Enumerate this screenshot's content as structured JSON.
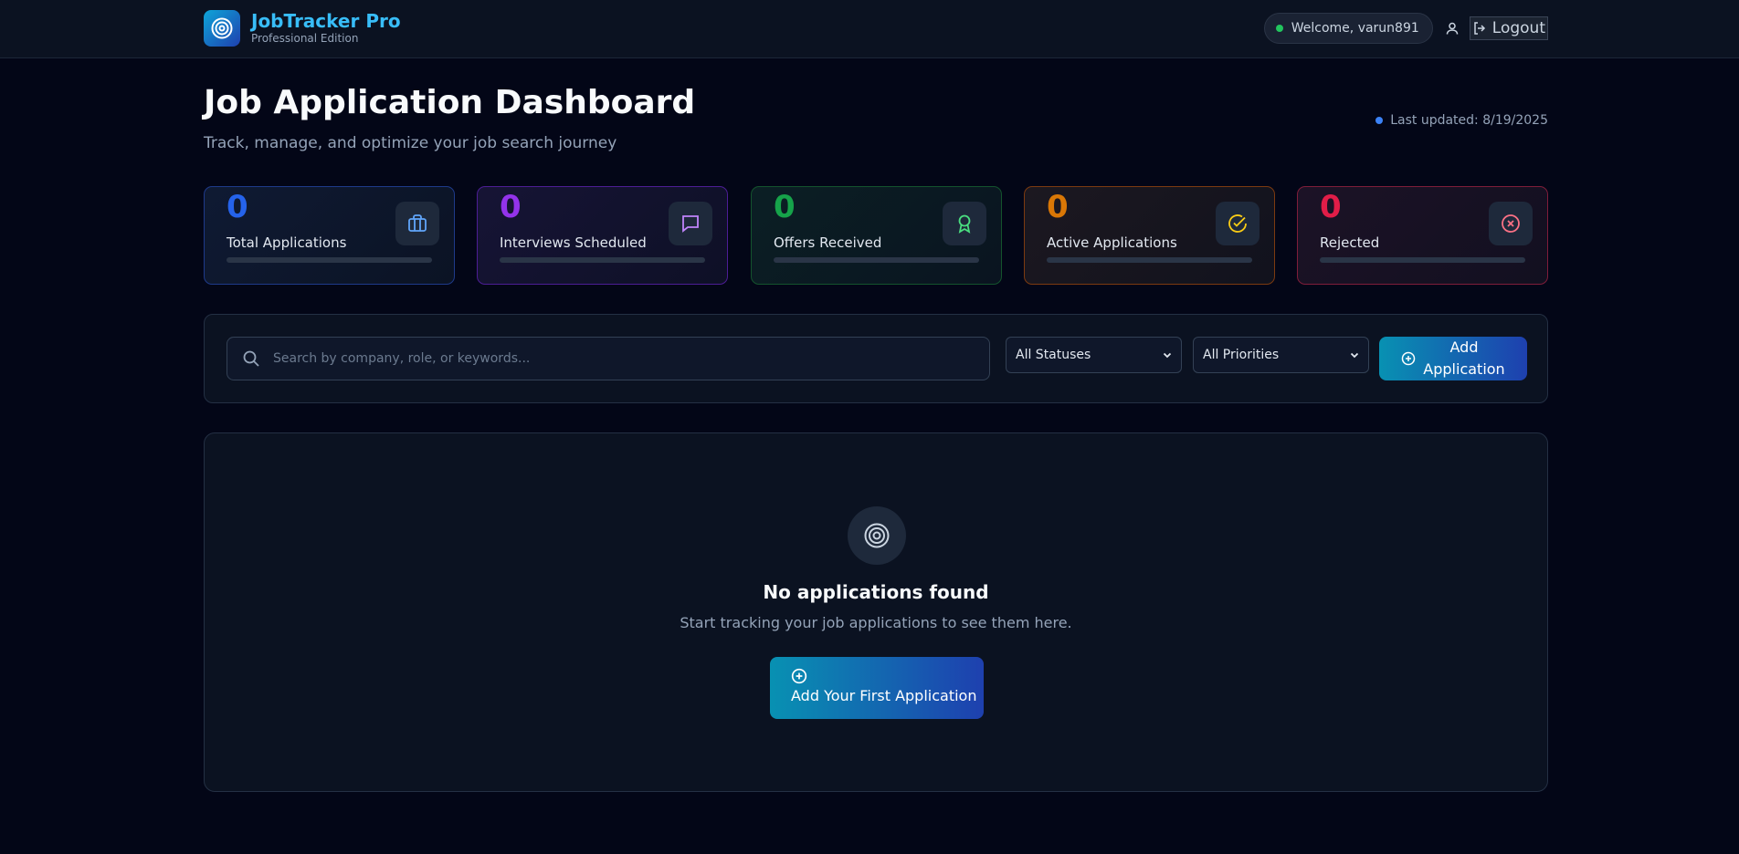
{
  "header": {
    "app_title": "JobTracker Pro",
    "app_subtitle": "Professional Edition",
    "welcome_text": "Welcome, varun891",
    "logout_label": "Logout"
  },
  "page": {
    "title": "Job Application Dashboard",
    "subtitle": "Track, manage, and optimize your job search journey",
    "last_updated": "Last updated: 8/19/2025"
  },
  "stats": [
    {
      "value": "0",
      "label": "Total Applications",
      "color": "#2563eb",
      "icon": "briefcase-icon"
    },
    {
      "value": "0",
      "label": "Interviews Scheduled",
      "color": "#9333ea",
      "icon": "message-icon"
    },
    {
      "value": "0",
      "label": "Offers Received",
      "color": "#16a34a",
      "icon": "award-icon"
    },
    {
      "value": "0",
      "label": "Active Applications",
      "color": "#d97706",
      "icon": "check-circle-icon"
    },
    {
      "value": "0",
      "label": "Rejected",
      "color": "#e11d48",
      "icon": "x-circle-icon"
    }
  ],
  "filters": {
    "search_placeholder": "Search by company, role, or keywords...",
    "status_selected": "All Statuses",
    "priority_selected": "All Priorities",
    "add_label_line1": "Add",
    "add_label_line2": "Application"
  },
  "empty_state": {
    "title": "No applications found",
    "subtitle": "Start tracking your job applications to see them here.",
    "button_label": "Add Your First Application"
  }
}
